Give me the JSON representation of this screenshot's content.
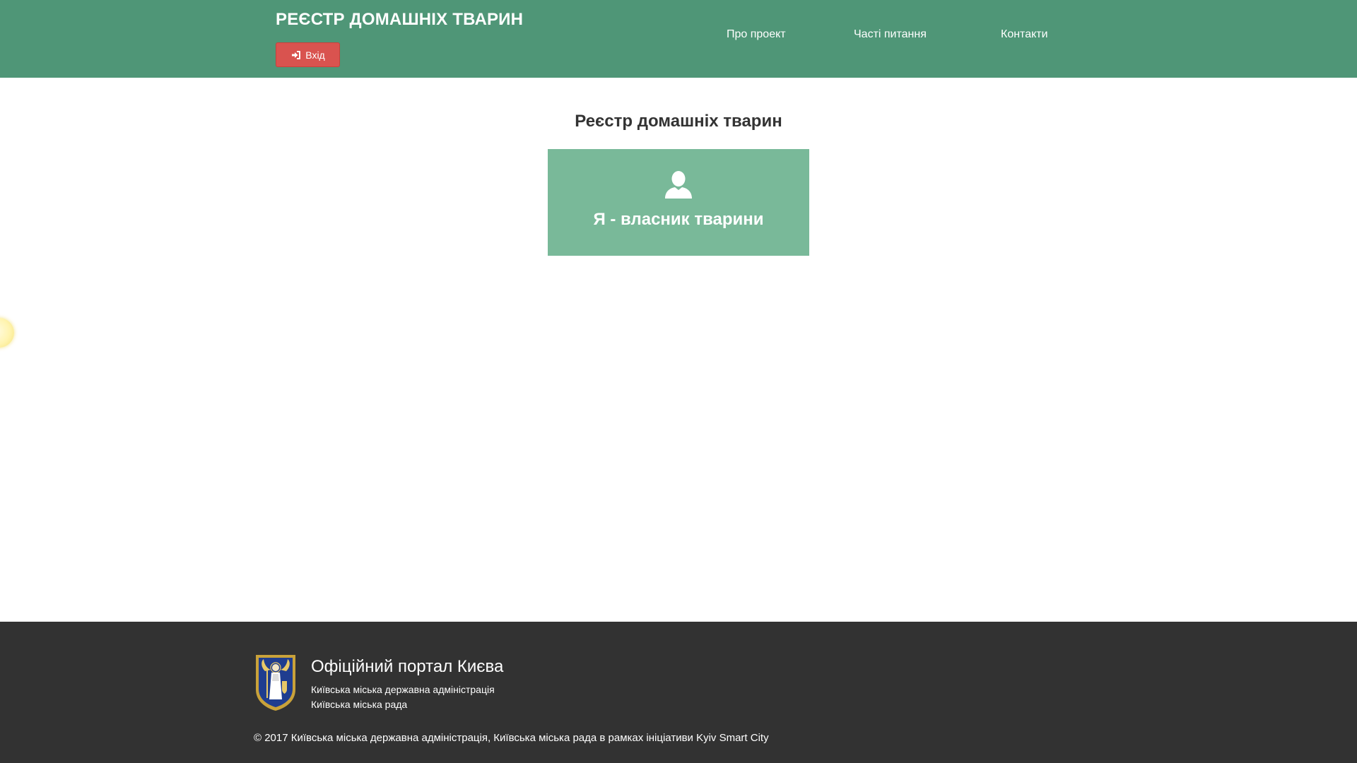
{
  "header": {
    "site_title": "РЕЄСТР ДОМАШНІХ ТВАРИН",
    "login_label": "Вхід",
    "nav": {
      "about": "Про проект",
      "faq": "Часті питання",
      "contacts": "Контакти"
    }
  },
  "main": {
    "title": "Реєстр домашніх тварин",
    "owner_card": {
      "icon": "user-icon",
      "label": "Я - власник тварини"
    }
  },
  "footer": {
    "portal_title": "Офіційний портал Києва",
    "lines": [
      "Київська міська державна адміністрація",
      "Київська міська рада"
    ],
    "copyright": "© 2017 Київська міська державна адміністрація, Київська міська рада в рамках ініціативи Kyiv Smart City"
  },
  "colors": {
    "header_bg": "#4f9677",
    "login_button": "#d9534f",
    "card_bg": "#79b999",
    "footer_bg": "#323232"
  }
}
